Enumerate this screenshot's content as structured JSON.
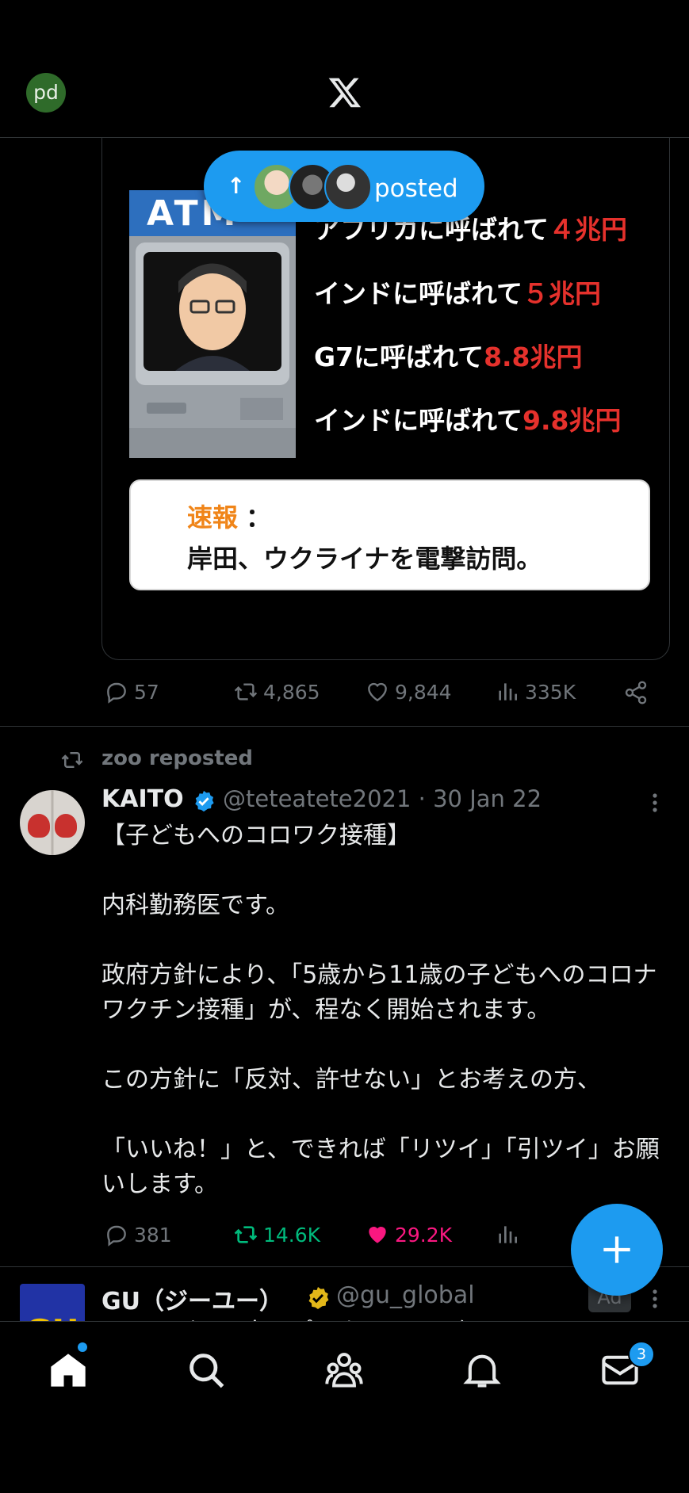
{
  "header": {
    "avatar_initials": "pd",
    "logo": "x-logo"
  },
  "first_tweet": {
    "image_text": {
      "atm_label": "ATM",
      "lines": [
        {
          "prefix": "アフリカに呼ばれて",
          "amount": "４兆円"
        },
        {
          "prefix": "インドに呼ばれて",
          "amount": "５兆円"
        },
        {
          "prefix": "G7に呼ばれて",
          "amount": "8.8兆円"
        },
        {
          "prefix": "インドに呼ばれて",
          "amount": "9.8兆円"
        }
      ],
      "news_label": "速報",
      "news_colon": "：",
      "news_text": "岸田、ウクライナを電撃訪問。"
    },
    "posted_pill": {
      "label": "posted",
      "arrow": "↑"
    },
    "actions": {
      "replies": "57",
      "reposts": "4,865",
      "likes": "9,844",
      "views": "335K"
    }
  },
  "second_tweet": {
    "repost_by": "zoo reposted",
    "author_name": "KAITO",
    "handle": "@teteatete2021",
    "date": "30 Jan 22",
    "meta_sep": " · ",
    "text": "【子どもへのコロワク接種】\n\n内科勤務医です。\n\n政府方針により、「5歳から11歳の子どもへのコロナワクチン接種」が、程なく開始されます。\n\nこの方針に「反対、許せない」とお考えの方、\n\n「いいね！」と、できれば「リツイ」「引ツイ」お願いします。",
    "actions": {
      "replies": "381",
      "reposts": "14.6K",
      "likes": "29.2K"
    }
  },
  "third_tweet": {
    "author_name": "GU（ジーユー）",
    "handle": "@gu_global",
    "ad_label": "Ad",
    "avatar_text": "GU",
    "text_partial": "シャイガーで全〜ポンター ドに〈"
  },
  "bottom_nav": {
    "messages_badge": "3"
  },
  "colors": {
    "accent": "#1d9bf0",
    "repost_green": "#00ba7c",
    "like_pink": "#f91880",
    "muted": "#71767b"
  }
}
